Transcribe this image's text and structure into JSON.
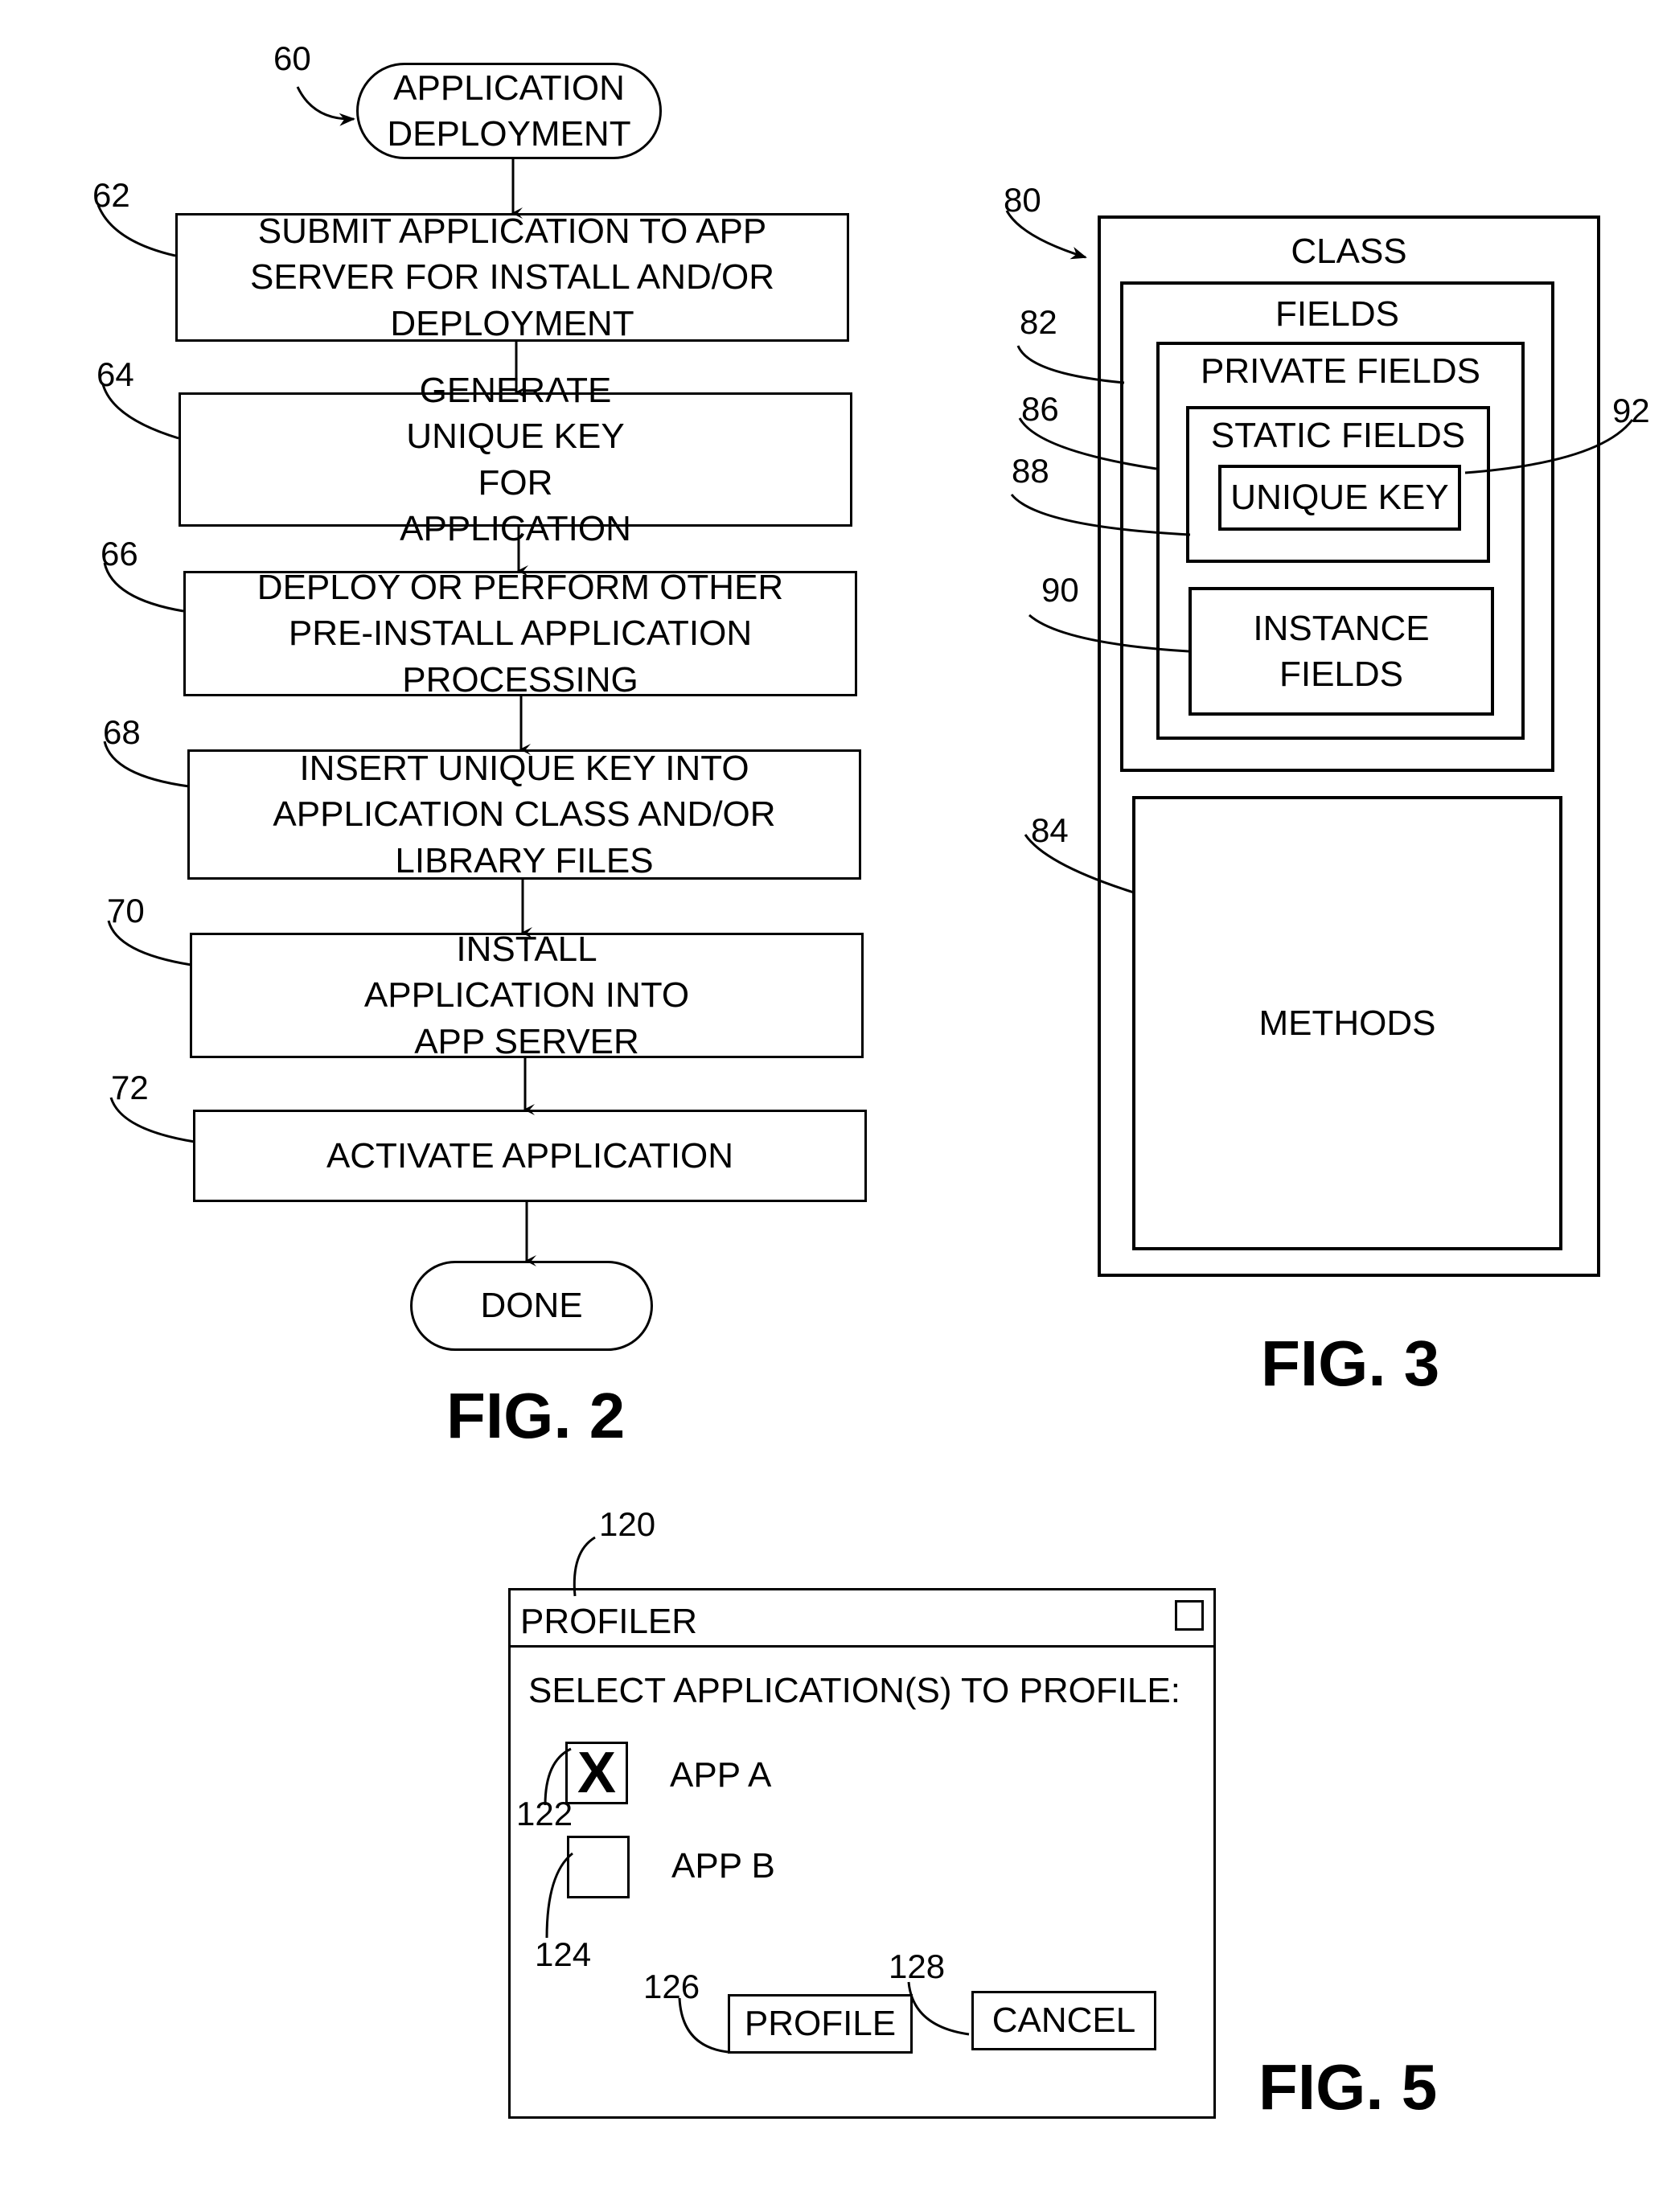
{
  "fig2": {
    "caption": "FIG. 2",
    "start": {
      "ref": "60",
      "text": "APPLICATION\nDEPLOYMENT"
    },
    "steps": [
      {
        "ref": "62",
        "text": "SUBMIT APPLICATION TO APP SERVER FOR INSTALL AND/OR DEPLOYMENT"
      },
      {
        "ref": "64",
        "text": "GENERATE UNIQUE KEY FOR APPLICATION"
      },
      {
        "ref": "66",
        "text": "DEPLOY OR PERFORM OTHER PRE-INSTALL APPLICATION PROCESSING"
      },
      {
        "ref": "68",
        "text": "INSERT UNIQUE KEY INTO APPLICATION CLASS AND/OR LIBRARY FILES"
      },
      {
        "ref": "70",
        "text": "INSTALL APPLICATION INTO APP SERVER"
      },
      {
        "ref": "72",
        "text": "ACTIVATE APPLICATION"
      }
    ],
    "end": {
      "text": "DONE"
    }
  },
  "fig3": {
    "caption": "FIG. 3",
    "class": {
      "ref": "80",
      "label": "CLASS"
    },
    "fields": {
      "ref": "82",
      "label": "FIELDS"
    },
    "private_fields": {
      "ref": "86",
      "label": "PRIVATE FIELDS"
    },
    "static_fields": {
      "ref": "88",
      "label": "STATIC FIELDS"
    },
    "unique_key": {
      "ref": "92",
      "label": "UNIQUE KEY"
    },
    "instance_fields": {
      "ref": "90",
      "label": "INSTANCE FIELDS"
    },
    "methods": {
      "ref": "84",
      "label": "METHODS"
    }
  },
  "fig5": {
    "caption": "FIG. 5",
    "window": {
      "ref": "120",
      "title": "PROFILER"
    },
    "prompt": "SELECT APPLICATION(S) TO PROFILE:",
    "apps": [
      {
        "ref": "122",
        "label": "APP A",
        "checked": true,
        "mark": "X"
      },
      {
        "ref": "124",
        "label": "APP B",
        "checked": false,
        "mark": ""
      }
    ],
    "buttons": {
      "profile": {
        "ref": "126",
        "label": "PROFILE"
      },
      "cancel": {
        "ref": "128",
        "label": "CANCEL"
      }
    }
  }
}
